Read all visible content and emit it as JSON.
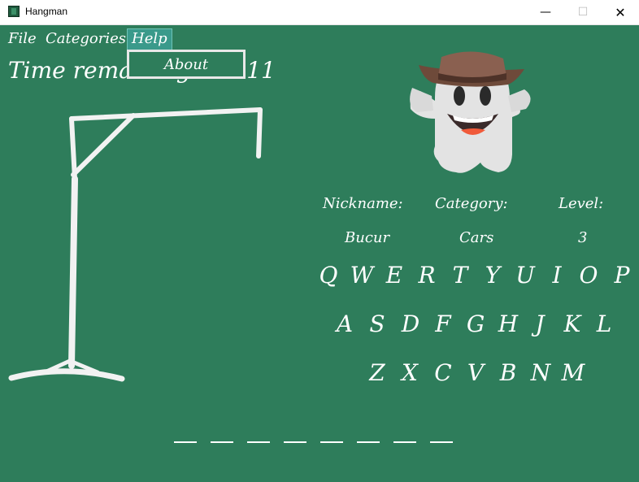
{
  "window": {
    "title": "Hangman",
    "min_symbol": "—",
    "max_symbol": "☐",
    "close_symbol": "✕"
  },
  "menu": {
    "file": "File",
    "categories": "Categories",
    "help": "Help",
    "help_items": [
      "About"
    ]
  },
  "timer": {
    "label": "Time remaining",
    "value": "0:11"
  },
  "player": {
    "nickname_label": "Nickname:",
    "category_label": "Category:",
    "level_label": "Level:",
    "nickname": "Bucur",
    "category": "Cars",
    "level": "3"
  },
  "keyboard": {
    "row1": [
      "Q",
      "W",
      "E",
      "R",
      "T",
      "Y",
      "U",
      "I",
      "O",
      "P"
    ],
    "row2": [
      "A",
      "S",
      "D",
      "F",
      "G",
      "H",
      "J",
      "K",
      "L"
    ],
    "row3": [
      "Z",
      "X",
      "C",
      "V",
      "B",
      "N",
      "M"
    ]
  },
  "word_length": 8
}
